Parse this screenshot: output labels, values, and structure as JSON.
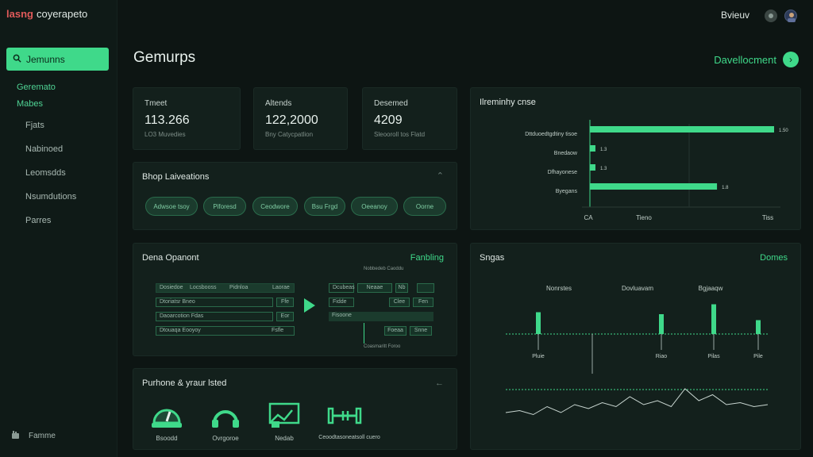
{
  "app": {
    "title": "coyerapeto",
    "logo_text": "lasng"
  },
  "topbar": {
    "user_label": "Bvieuv"
  },
  "sidebar": {
    "search_label": "Jemunns",
    "sections": [
      "Geremato",
      "Mabes"
    ],
    "items": [
      "Fjats",
      "Nabinoed",
      "Leomsdds",
      "Nsumdutions",
      "Parres"
    ],
    "footer_label": "Famme"
  },
  "page": {
    "title": "Gemurps",
    "action_label": "Davellocment"
  },
  "stats": [
    {
      "label": "Tmeet",
      "value": "113.266",
      "sub": "LO3 Muvedies"
    },
    {
      "label": "Altends",
      "value": "122,2000",
      "sub": "Bny Catycpatlion"
    },
    {
      "label": "Desemed",
      "value": "4209",
      "sub": "Sleooroll tos Flatd"
    }
  ],
  "shop": {
    "title": "Bhop Laiveations",
    "pills": [
      "Adwsoe tsoy",
      "Piforesd",
      "Ceodwore",
      "Bsu Frgd",
      "Oeeanoy",
      "Oorne"
    ]
  },
  "demo": {
    "title": "Dena Opanont",
    "action": "Fanbling",
    "top_label": "Nobbedeb Caoddu",
    "left_rows": [
      [
        "Dosiedoe",
        "Locsbooss",
        "Pidnloa",
        "Laorae"
      ],
      [
        "Dtoriatsr Bneo",
        "Ffe"
      ],
      [
        "Daoarcotion Fdas",
        "Eor"
      ],
      [
        "Dtouaqa Eooyoy",
        "Fsfle"
      ]
    ],
    "right_rows": [
      [
        "Dcubeas",
        "Neaae",
        "Nb"
      ],
      [
        "Fidde",
        "Clee",
        "Fen"
      ],
      [
        "Fisoone",
        "Foeaa",
        "Snne"
      ]
    ],
    "bottom_label": "Coasmaritt Foroo"
  },
  "purchase": {
    "title": "Purhone & yraur lsted",
    "items": [
      {
        "icon": "gauge-icon",
        "label": "Bsoodd"
      },
      {
        "icon": "headphones-icon",
        "label": "Ovrgoroe"
      },
      {
        "icon": "ticket-icon",
        "label": "Nedab"
      },
      {
        "icon": "dumbbell-icon",
        "label": "Ceoodtasoneatsoll cuero"
      }
    ]
  },
  "accent_color": "#3fd98a",
  "chart_data": [
    {
      "type": "bar",
      "title": "Ilreminhy cnse",
      "orientation": "horizontal",
      "categories": [
        "Dttduoedtgdtiny tisoe",
        "Bnedaow",
        "Dfhayonese",
        "Byegans"
      ],
      "values": [
        100,
        3,
        3,
        69
      ],
      "value_labels": [
        "1.50",
        "1.3",
        "1.3",
        "1.8"
      ],
      "xaxis_labels": [
        "CA",
        "Tieno",
        "Tiss"
      ]
    },
    {
      "type": "scatter",
      "title": "Sngas",
      "action": "Domes",
      "column_labels": [
        "Nonrstes",
        "Dovluavam",
        "Bgjaaqw"
      ],
      "spike_values": [
        0.55,
        0.5,
        0.75,
        0.35
      ],
      "spike_labels": [
        "Pluie",
        "Riao",
        "Pilas",
        "Pile"
      ],
      "line_values": [
        0.3,
        0.35,
        0.25,
        0.45,
        0.3,
        0.5,
        0.4,
        0.55,
        0.45,
        0.7,
        0.5,
        0.6,
        0.45,
        0.9,
        0.6,
        0.75,
        0.5,
        0.55,
        0.45,
        0.5
      ]
    }
  ]
}
